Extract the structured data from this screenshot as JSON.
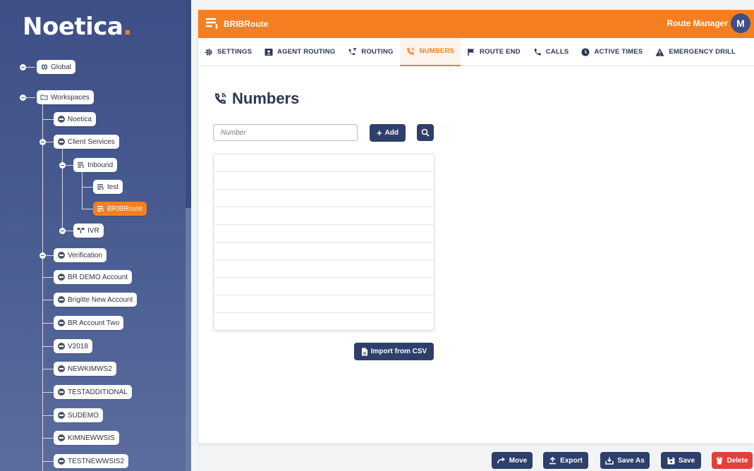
{
  "brand": {
    "logo_text": "Noetica",
    "logo_dot": "."
  },
  "sidebar": {
    "nodes": {
      "global": "Global",
      "workspaces": "Workspaces",
      "noetica": "Noetica",
      "client_services": "Client Services",
      "inbound": "Inbound",
      "test": "test",
      "bribroute": "BRIBRoute",
      "ivr": "IVR",
      "verification": "Verification",
      "br_demo": "BR DEMO Account",
      "brigitte": "Brigitte New Account",
      "br_two": "BR Account Two",
      "v2018": "V2018",
      "newkimws2": "NEWKIMWS2",
      "testadditional": "TESTADDITIONAL",
      "sudemo": "SUDEMO",
      "kimnewwsis": "KIMNEWWSIS",
      "testnewwsis2": "TESTNEWWSIS2"
    }
  },
  "topbar": {
    "route_name": "BRIBRoute",
    "app_title": "Route Manager",
    "avatar_letter": "M"
  },
  "tabs": {
    "settings": "SETTINGS",
    "agent_routing": "AGENT ROUTING",
    "routing": "ROUTING",
    "numbers": "NUMBERS",
    "route_end": "ROUTE END",
    "calls": "CALLS",
    "active_times": "ACTIVE TIMES",
    "emergency_drill": "EMERGENCY DRILL"
  },
  "content": {
    "title": "Numbers",
    "number_placeholder": "Number",
    "add_label": "Add",
    "import_label": "Import from CSV"
  },
  "footer": {
    "move": "Move",
    "export": "Export",
    "save_as": "Save As",
    "save": "Save",
    "delete": "Delete"
  },
  "colors": {
    "accent": "#f57f20",
    "navy": "#2f3f6b",
    "sidebar": "#3d4f86",
    "danger": "#e2403b"
  }
}
